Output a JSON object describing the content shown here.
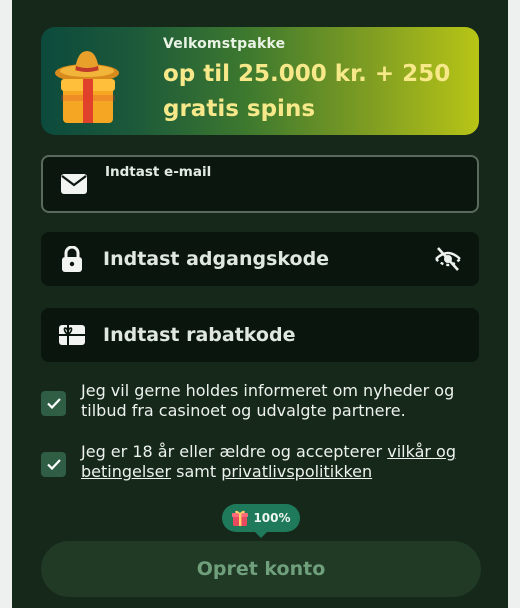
{
  "banner": {
    "eyebrow": "Velkomstpakke",
    "headline": "op til 25.000 kr. + 250 gratis spins"
  },
  "email_field": {
    "label": "Indtast e-mail",
    "value": ""
  },
  "password_field": {
    "placeholder": "Indtast adgangskode"
  },
  "promo_field": {
    "placeholder": "Indtast rabatkode"
  },
  "consents": {
    "marketing": {
      "checked": true,
      "text": "Jeg vil gerne holdes informeret om nyheder og tilbud fra casinoet og udvalgte partnere."
    },
    "terms": {
      "checked": true,
      "prefix": "Jeg er 18 år eller ældre og accepterer ",
      "link1": "vilkår og betingelser",
      "middle": " samt ",
      "link2": "privatlivspolitikken"
    }
  },
  "badge": {
    "label": "100%"
  },
  "submit": {
    "label": "Opret konto"
  },
  "colors": {
    "background": "#15281a",
    "accent_text": "#f7e98a",
    "checkbox": "#2f5e45",
    "badge": "#1f7a5c",
    "submit_text": "#6f9f7b"
  }
}
